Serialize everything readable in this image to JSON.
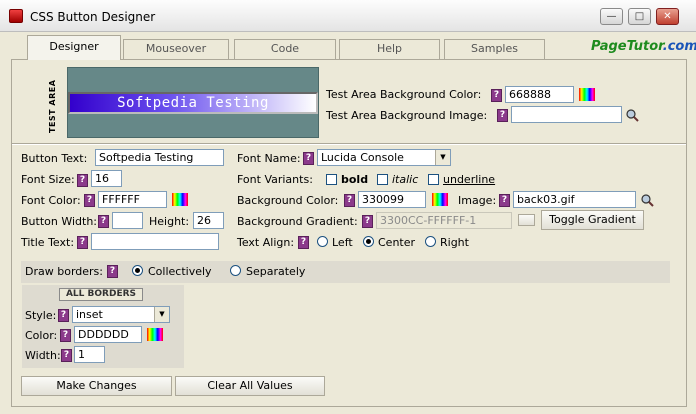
{
  "window": {
    "title": "CSS Button Designer"
  },
  "tabs": [
    {
      "label": "Designer"
    },
    {
      "label": "Mouseover"
    },
    {
      "label": "Code"
    },
    {
      "label": "Help"
    },
    {
      "label": "Samples"
    }
  ],
  "logo": {
    "main": "PageTutor",
    "tld": ".com"
  },
  "test_area": {
    "vertical_label": "TEST AREA",
    "button_text": "Softpedia Testing",
    "bg_color_label": "Test Area Background Color:",
    "bg_color_value": "668888",
    "bg_image_label": "Test Area Background Image:",
    "bg_image_value": ""
  },
  "left": {
    "button_text_label": "Button Text:",
    "button_text_value": "Softpedia Testing",
    "font_size_label": "Font Size:",
    "font_size_value": "16",
    "font_color_label": "Font Color:",
    "font_color_value": "FFFFFF",
    "button_width_label": "Button Width:",
    "button_width_value": "",
    "height_label": "Height:",
    "height_value": "26",
    "title_text_label": "Title Text:",
    "title_text_value": ""
  },
  "right": {
    "font_name_label": "Font Name:",
    "font_name_value": "Lucida Console",
    "font_variants_label": "Font Variants:",
    "bold_label": "bold",
    "italic_label": "italic",
    "underline_label": "underline",
    "bg_color_label": "Background Color:",
    "bg_color_value": "330099",
    "image_label": "Image:",
    "image_value": "back03.gif",
    "gradient_label": "Background Gradient:",
    "gradient_value": "3300CC-FFFFFF-1",
    "toggle_gradient_label": "Toggle Gradient",
    "text_align_label": "Text Align:",
    "align_left": "Left",
    "align_center": "Center",
    "align_right": "Right"
  },
  "borders": {
    "draw_label": "Draw borders:",
    "collectively": "Collectively",
    "separately": "Separately",
    "all_borders_header": "ALL BORDERS",
    "style_label": "Style:",
    "style_value": "inset",
    "color_label": "Color:",
    "color_value": "DDDDDD",
    "width_label": "Width:",
    "width_value": "1"
  },
  "actions": {
    "make_changes": "Make Changes",
    "clear_all": "Clear All Values"
  },
  "help_marker": "?",
  "colors": {
    "test_area_bg": "#668888",
    "button_gradient_start": "#3300cc",
    "button_gradient_end": "#ffffff",
    "help_icon": "#8b3a8b"
  }
}
